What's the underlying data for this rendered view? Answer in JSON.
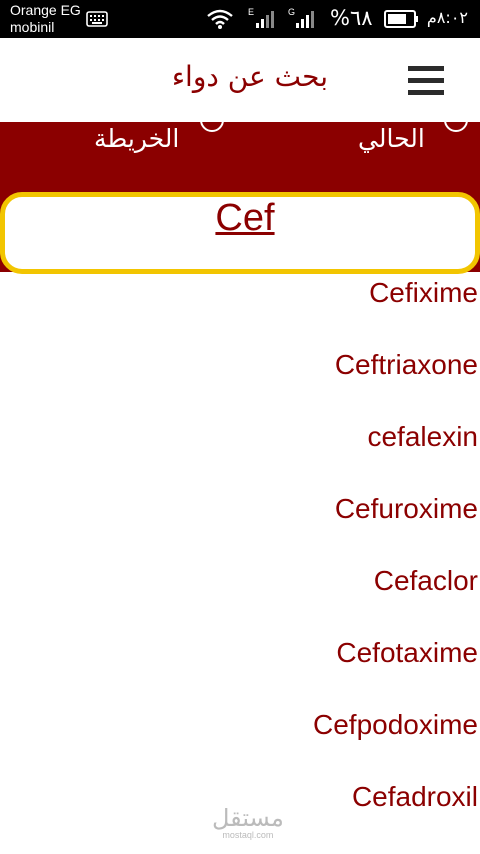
{
  "status_bar": {
    "carrier_line1": "Orange EG",
    "carrier_line2": "mobinil",
    "net1": "E",
    "net2": "G",
    "battery_text": "%٦٨",
    "time": "٨:٠٢م",
    "icons": [
      "keyboard-icon",
      "wifi-icon",
      "signal-icon",
      "signal-icon",
      "battery-icon"
    ]
  },
  "app_bar": {
    "title": "بحث عن دواء",
    "menu_icon": "menu-icon"
  },
  "location_options": {
    "map_label": "الخريطة",
    "current_label": "الحالي"
  },
  "search": {
    "query": "Cef"
  },
  "results": [
    "Cefixime",
    "Ceftriaxone",
    "cefalexin",
    "Cefuroxime",
    "Cefaclor",
    "Cefotaxime",
    "Cefpodoxime",
    "Cefadroxil"
  ],
  "watermark": {
    "main": "مستقل",
    "sub": "mostaql.com"
  },
  "colors": {
    "accent": "#8b0000",
    "search_border": "#f2c500"
  }
}
